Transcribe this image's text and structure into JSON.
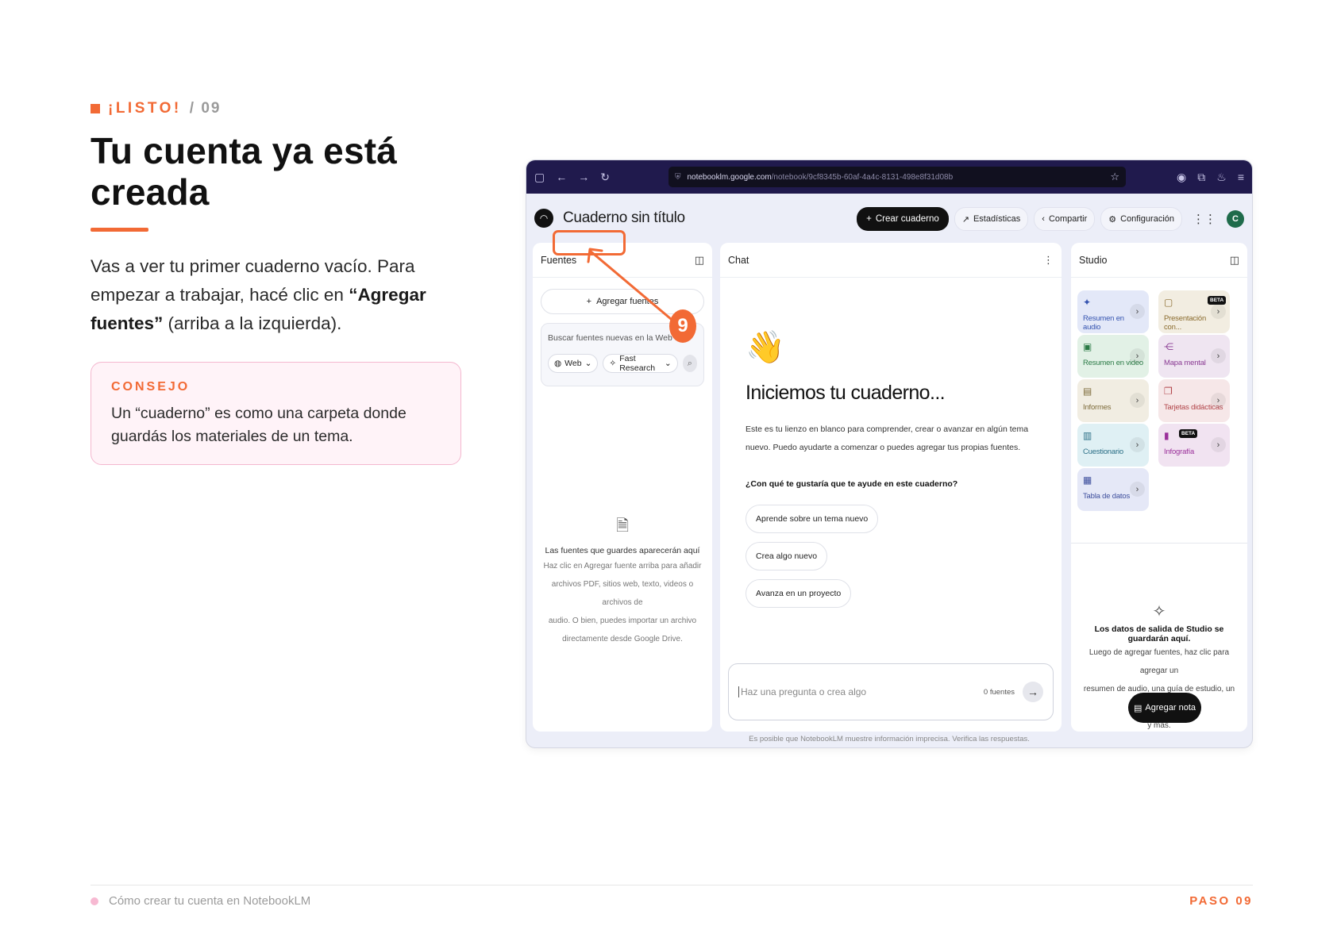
{
  "eyebrow": {
    "tag": "¡LISTO!",
    "number": "/ 09"
  },
  "title": "Tu cuenta ya está creada",
  "lead": {
    "part1": "Vas a ver tu primer cuaderno vacío. Para empezar a trabajar, hacé clic en ",
    "bold": "“Agregar fuentes”",
    "part2": " (arriba a la izquierda)."
  },
  "tip": {
    "label": "CONSEJO",
    "body": "Un “cuaderno” es como una carpeta donde guardás los materiales de un tema."
  },
  "footer": {
    "left": "Cómo crear tu cuenta en NotebookLM",
    "right": "PASO 09"
  },
  "colors": {
    "accent": "#f26a35",
    "tip_border": "#f4b7cf",
    "tip_bg": "#fff3f8"
  },
  "screenshot": {
    "browser": {
      "url_host": "notebooklm.google.com",
      "url_path": "/notebook/9cf8345b-60af-4a4c-8131-498e8f31d08b"
    },
    "app": {
      "notebook_title": "Cuaderno sin título",
      "create_button": "Crear cuaderno",
      "stats_button": "Estadísticas",
      "share_button": "Compartir",
      "settings_button": "Configuración",
      "avatar_initial": "C"
    },
    "sources": {
      "header": "Fuentes",
      "add_button": "Agregar fuentes",
      "search_placeholder": "Buscar fuentes nuevas en la Web",
      "web_chip": "Web",
      "research_chip": "Fast Research",
      "empty_title": "Las fuentes que guardes aparecerán aquí",
      "empty_l1": "Haz clic en Agregar fuente arriba para añadir",
      "empty_l2": "archivos PDF, sitios web, texto, videos o archivos de",
      "empty_l3": "audio. O bien, puedes importar un archivo",
      "empty_l4": "directamente desde Google Drive."
    },
    "chat": {
      "header": "Chat",
      "heading": "Iniciemos tu cuaderno...",
      "paragraph": "Este es tu lienzo en blanco para comprender, crear o avanzar en algún tema nuevo. Puedo ayudarte a comenzar o puedes agregar tus propias fuentes.",
      "question": "¿Con qué te gustaría que te ayude en este cuaderno?",
      "suggestion1": "Aprende sobre un tema nuevo",
      "suggestion2": "Crea algo nuevo",
      "suggestion3": "Avanza en un proyecto",
      "input_placeholder": "Haz una pregunta o crea algo",
      "sources_count": "0 fuentes"
    },
    "studio": {
      "header": "Studio",
      "audio": "Resumen en audio",
      "presentation": "Presentación con...",
      "video": "Resumen en video",
      "mindmap": "Mapa mental",
      "reports": "Informes",
      "flashcards": "Tarjetas didácticas",
      "quiz": "Cuestionario",
      "infographic": "Infografía",
      "datatable": "Tabla de datos",
      "beta": "BETA",
      "empty_title": "Los datos de salida de Studio se guardarán aquí.",
      "empty_l1": "Luego de agregar fuentes, haz clic para agregar un",
      "empty_l2": "resumen de audio, una guía de estudio, un mapa mental",
      "empty_l3": "y más.",
      "add_note": "Agregar nota"
    },
    "disclaimer": "Es posible que NotebookLM muestre información imprecisa. Verifica las respuestas.",
    "step_badge": "9"
  }
}
